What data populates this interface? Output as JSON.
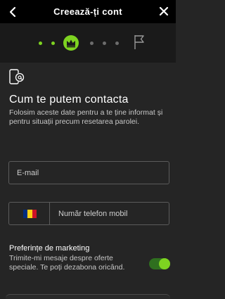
{
  "header": {
    "title": "Creează-ți cont",
    "back_icon": "chevron-left-icon",
    "close_icon": "close-icon"
  },
  "stepper": {
    "total_steps": 7,
    "current_step": 3,
    "active_icon": "crown-icon",
    "final_icon": "flag-icon",
    "colors": {
      "done": "#7ed321",
      "todo": "#6d6d6d",
      "accent": "#7ed321"
    }
  },
  "contact": {
    "icon": "phone-at-icon",
    "title": "Cum te putem contacta",
    "description": "Folosim aceste date pentru a te ține informat și pentru situații precum resetarea parolei."
  },
  "email": {
    "placeholder": "E-mail",
    "value": ""
  },
  "phone": {
    "country_flag": "romania-flag-icon",
    "flag_colors": [
      "#002b7f",
      "#fcd116",
      "#ce1126"
    ],
    "placeholder": "Număr telefon mobil",
    "value": ""
  },
  "marketing": {
    "title": "Preferințe de marketing",
    "description": "Trimite-mi mesaje despre oferte speciale. Te poți dezabona oricând.",
    "enabled": true
  }
}
